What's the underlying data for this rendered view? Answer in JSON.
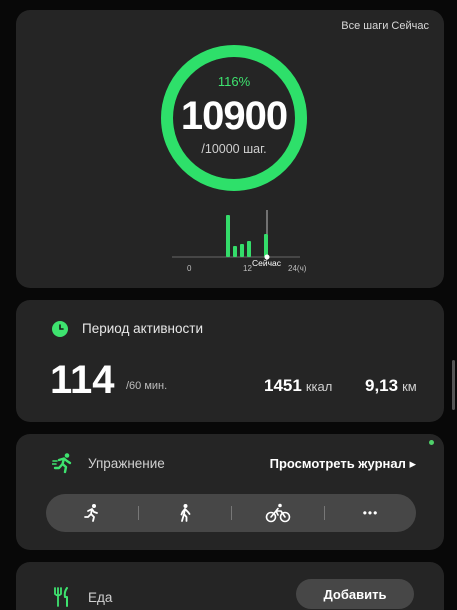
{
  "steps": {
    "all_steps_link": "Все шаги Сейчас",
    "percent": "116%",
    "value": "10900",
    "goal": "/10000 шаг.",
    "progress_fraction": 1.0,
    "ring_color": "#2ee06a",
    "chart": {
      "tick_start": "0",
      "tick_mid": "12",
      "tick_now": "Сейчас",
      "tick_end": "24(ч)"
    }
  },
  "activity": {
    "title": "Период активности",
    "minutes": "114",
    "goal": "/60 мин.",
    "calories_value": "1451",
    "calories_unit": "ккал",
    "distance_value": "9,13",
    "distance_unit": "км",
    "icon": "clock-icon",
    "accent": "#3ee36f"
  },
  "exercise": {
    "title": "Упражнение",
    "view_log": "Просмотреть журнал ▸",
    "types": [
      "running-icon",
      "walking-icon",
      "cycling-icon",
      "more-icon"
    ],
    "more_label": "•••"
  },
  "food": {
    "title": "Еда",
    "add_button": "Добавить"
  }
}
